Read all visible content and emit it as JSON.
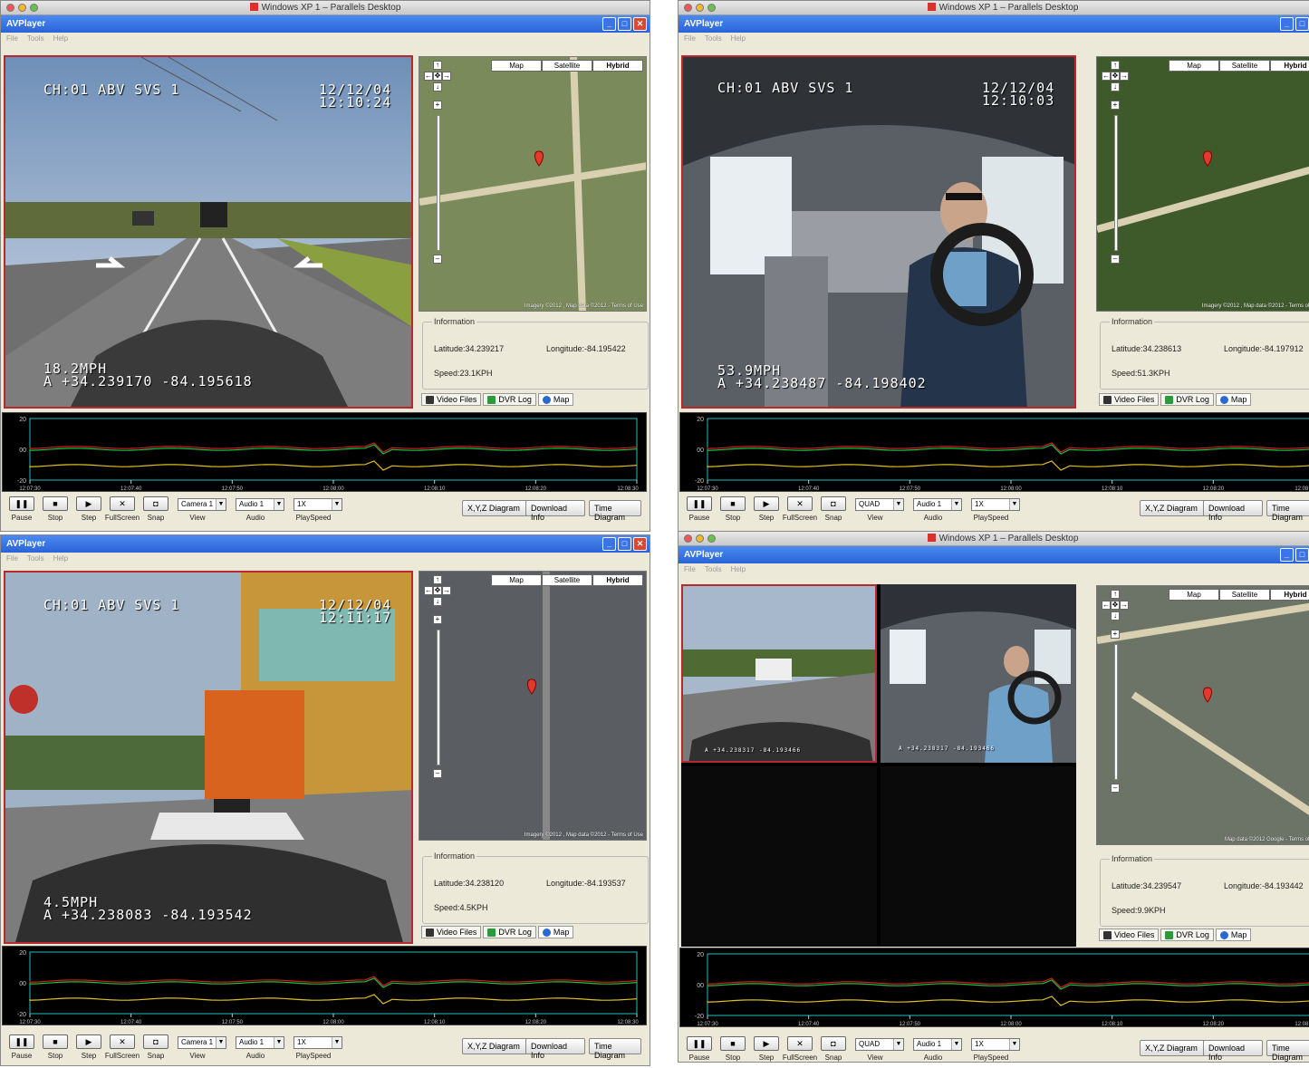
{
  "app": {
    "mac_title": "Windows XP 1 – Parallels Desktop",
    "title": "AVPlayer",
    "menu": [
      "File",
      "Tools",
      "Help"
    ]
  },
  "map": {
    "tabs": [
      "Map",
      "Satellite",
      "Hybrid"
    ],
    "selected_tab": "Hybrid",
    "credit_a": "Imagery ©2012 , Map data ©2012 - Terms of Use",
    "credit_b": "Map data ©2012 Google - Terms of Use"
  },
  "info_legend": "Information",
  "bottom_tabs": [
    "Video Files",
    "DVR Log",
    "Map"
  ],
  "controls": {
    "buttons": [
      "Pause",
      "Stop",
      "Step",
      "FullScreen",
      "Snap"
    ],
    "labels": [
      "View",
      "Audio",
      "PlaySpeed"
    ],
    "right_buttons": [
      "X,Y,Z Diagram",
      "Download Info",
      "Time Diagram"
    ]
  },
  "graph": {
    "y_labels": [
      "20",
      "00",
      "-20"
    ],
    "x_labels": [
      "12:07:30",
      "12:07:40",
      "12:07:50",
      "12:08:00",
      "12:08:10",
      "12:08:20",
      "12:08:30"
    ]
  },
  "panels": [
    {
      "osd_channel": "CH:01 ABV SVS 1",
      "osd_date": "12/12/04",
      "osd_time": "12:10:24",
      "osd_speed": "18.2MPH",
      "osd_gps": "A +34.239170 -84.195618",
      "latitude": "Latitude:34.239217",
      "longitude": "Longitude:-84.195422",
      "speed": "Speed:23.1KPH",
      "view": "Camera 1",
      "audio": "Audio 1",
      "playspeed": "1X"
    },
    {
      "osd_channel": "CH:01 ABV SVS 1",
      "osd_date": "12/12/04",
      "osd_time": "12:10:03",
      "osd_speed": "53.9MPH",
      "osd_gps": "A +34.238487 -84.198402",
      "latitude": "Latitude:34.238613",
      "longitude": "Longitude:-84.197912",
      "speed": "Speed:51.3KPH",
      "view": "QUAD",
      "audio": "Audio 1",
      "playspeed": "1X"
    },
    {
      "osd_channel": "CH:01 ABV SVS 1",
      "osd_date": "12/12/04",
      "osd_time": "12:11:17",
      "osd_speed": "4.5MPH",
      "osd_gps": "A +34.238083 -84.193542",
      "latitude": "Latitude:34.238120",
      "longitude": "Longitude:-84.193537",
      "speed": "Speed:4.5KPH",
      "view": "Camera 1",
      "audio": "Audio 1",
      "playspeed": "1X"
    },
    {
      "latitude": "Latitude:34.239547",
      "longitude": "Longitude:-84.193442",
      "speed": "Speed:9.9KPH",
      "view": "QUAD",
      "audio": "Audio 1",
      "playspeed": "1X",
      "quad_gps_a": "A +34.238317 -84.193466",
      "quad_gps_b": "A +34.238317 -84.193466"
    }
  ],
  "colors": {
    "video_border": "#b8282c",
    "graph_red": "#d02020",
    "graph_green": "#20c040",
    "graph_yellow": "#e0c020",
    "graph_frame": "#20c0c0"
  }
}
